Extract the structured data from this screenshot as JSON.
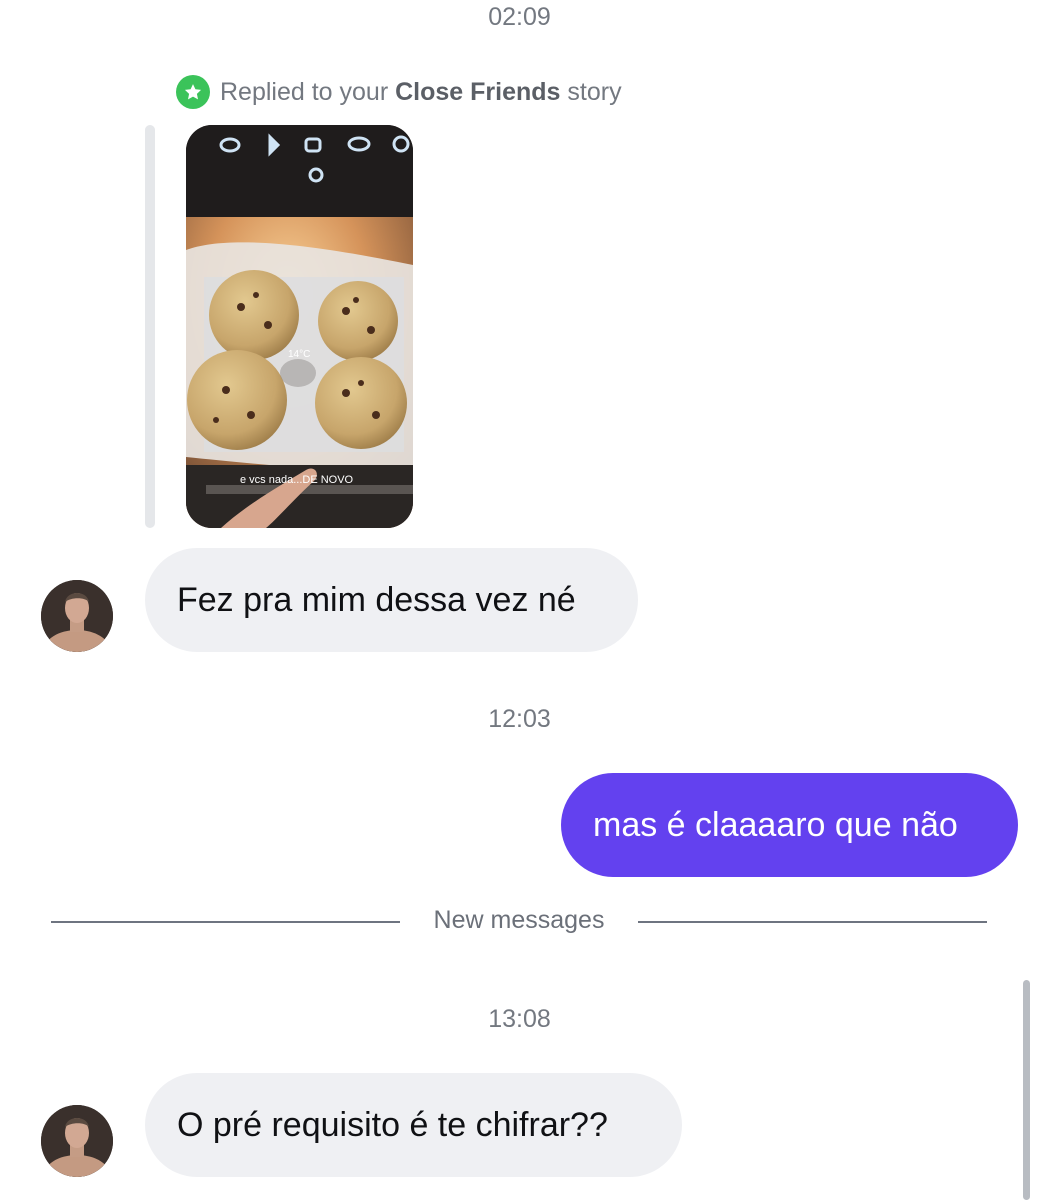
{
  "conversation": {
    "timestamps": [
      "02:09",
      "12:03",
      "13:08"
    ],
    "story_reply": {
      "prefix": "Replied to your",
      "story_type": "Close Friends",
      "suffix": "story",
      "badge_icon": "star-icon",
      "badge_color": "#3bc35a",
      "story": {
        "temperature_label": "14°C",
        "caption": "e vcs nada...DE NOVO"
      }
    },
    "messages": [
      {
        "sender": "them",
        "text": "Fez pra mim dessa vez né"
      },
      {
        "sender": "me",
        "text": "mas é claaaaro que não"
      },
      {
        "sender": "them",
        "text": "O pré requisito é te chifrar??"
      }
    ],
    "new_messages_label": "New messages",
    "colors": {
      "outgoing_bubble": "#6341ef",
      "incoming_bubble": "#eff0f3"
    }
  }
}
